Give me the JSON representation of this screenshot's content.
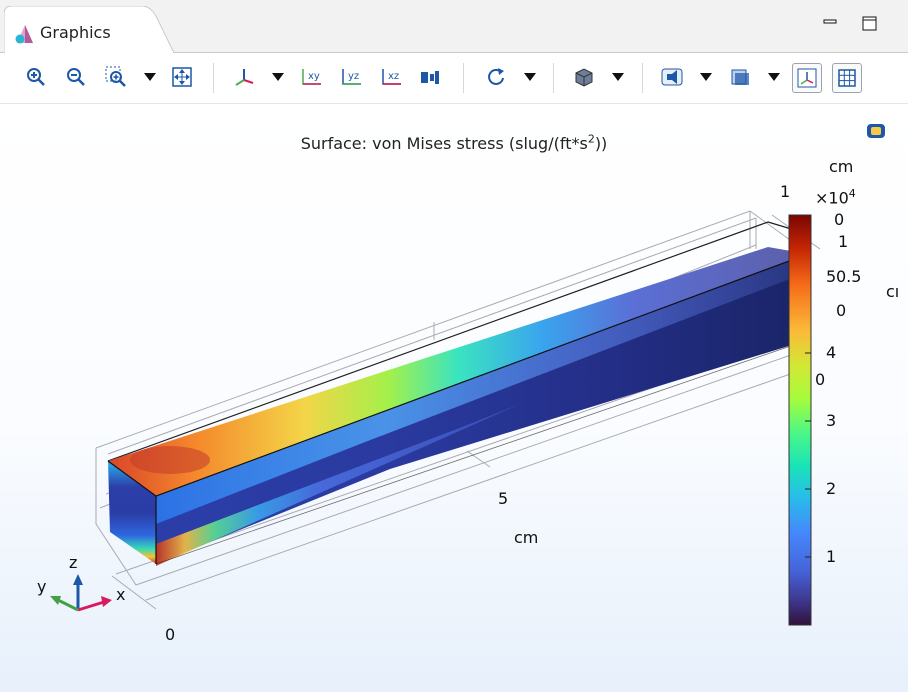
{
  "window": {
    "tab_title": "Graphics",
    "minimize_icon": "minimize-icon",
    "maximize_icon": "maximize-icon"
  },
  "toolbar": {
    "items": [
      "zoom-in-icon",
      "zoom-out-icon",
      "zoom-box-icon",
      "zoom-extents-icon",
      "axis-orientation-icon",
      "xy-plane-icon",
      "yz-plane-icon",
      "xz-plane-icon",
      "go-to-view-icon",
      "rotate-icon",
      "render-mode-icon",
      "lighting-icon",
      "transparency-icon",
      "show-axes-icon",
      "show-grid-icon"
    ]
  },
  "plot": {
    "title_main": "Surface: von Mises stress (slug/(ft*s",
    "title_sup": "2",
    "title_end": "))",
    "axis_unit_x": "cm",
    "axis_unit_top": "cm",
    "axis_unit_right": "cı",
    "tick_x_0": "0",
    "tick_x_5": "5",
    "tick_top_1": "1",
    "tick_right_5": "5",
    "tick_right_0": "0",
    "tick_right_1": "1",
    "tick_right_05": "0.5",
    "tick_right_00": "0",
    "tick_cb_top0": "0"
  },
  "colorbar": {
    "exponent_base": "×10",
    "exponent_power": "4",
    "ticks": [
      "4",
      "3",
      "2",
      "1"
    ],
    "colors": [
      "#7a0403",
      "#c42503",
      "#f66b19",
      "#fbb938",
      "#d2e935",
      "#a4fc3c",
      "#4df884",
      "#1ae4b6",
      "#28bceb",
      "#4686fb",
      "#4662d7",
      "#3e378f",
      "#30123b"
    ]
  },
  "triad": {
    "x_label": "x",
    "y_label": "y",
    "z_label": "z"
  }
}
